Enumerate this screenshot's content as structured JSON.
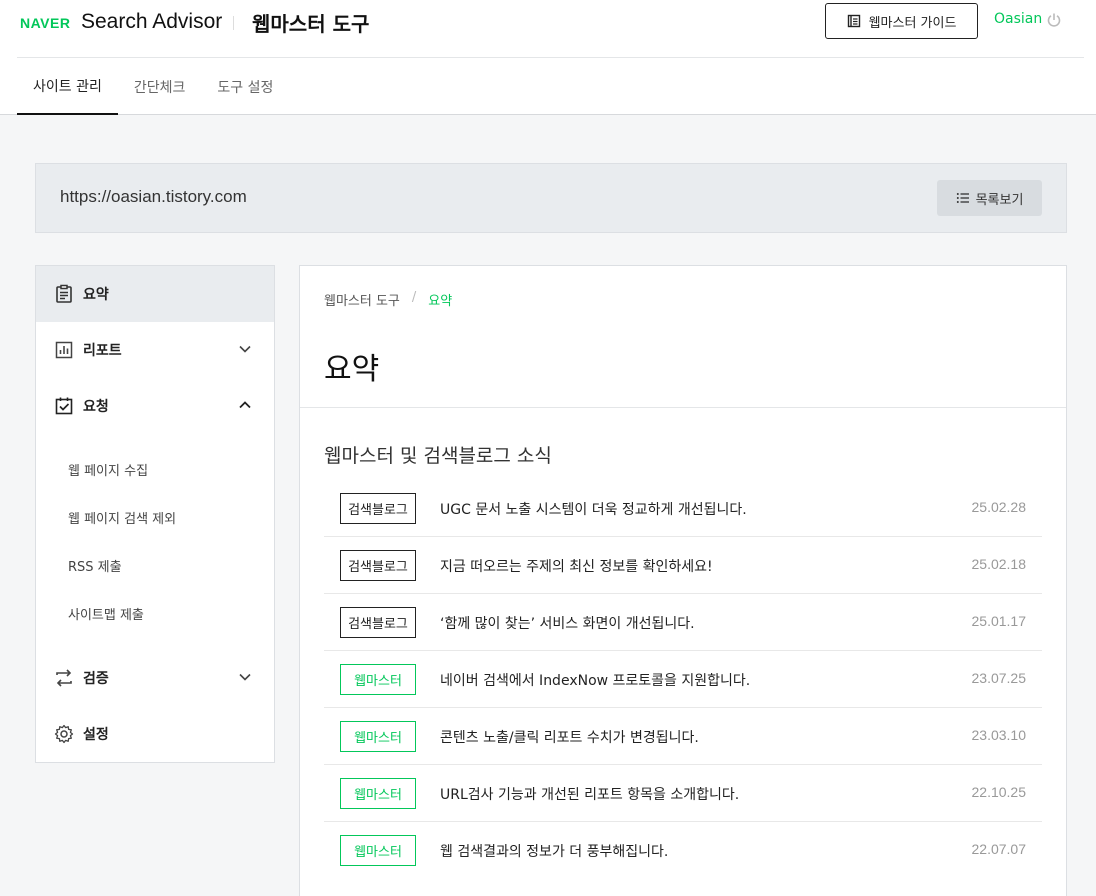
{
  "header": {
    "logo_brand": "NAVER",
    "logo_product": "Search Advisor",
    "logo_section": "웹마스터 도구",
    "guide_label": "웹마스터 가이드",
    "user_name": "Oasian",
    "accent": "#03c75a"
  },
  "tabs": [
    {
      "label": "사이트 관리",
      "active": true
    },
    {
      "label": "간단체크",
      "active": false
    },
    {
      "label": "도구 설정",
      "active": false
    }
  ],
  "site": {
    "url": "https://oasian.tistory.com",
    "list_label": "목록보기"
  },
  "sidebar": {
    "items": [
      {
        "label": "요약",
        "icon": "clipboard-icon",
        "active": true
      },
      {
        "label": "리포트",
        "icon": "chart-icon",
        "expanded": false
      },
      {
        "label": "요청",
        "icon": "checklist-icon",
        "expanded": true
      },
      {
        "label": "검증",
        "icon": "sync-icon",
        "expanded": false
      },
      {
        "label": "설정",
        "icon": "gear-icon"
      }
    ],
    "sub_items": [
      "웹 페이지 수집",
      "웹 페이지 검색 제외",
      "RSS 제출",
      "사이트맵 제출"
    ]
  },
  "main": {
    "breadcrumb": [
      "웹마스터 도구",
      "요약"
    ],
    "title": "요약",
    "section_title": "웹마스터 및 검색블로그 소식",
    "news": [
      {
        "badge": "검색블로그",
        "title": "UGC 문서 노출 시스템이 더욱 정교하게 개선됩니다.",
        "date": "25.02.28"
      },
      {
        "badge": "검색블로그",
        "title": "지금 떠오르는 주제의 최신 정보를 확인하세요!",
        "date": "25.02.18"
      },
      {
        "badge": "검색블로그",
        "title": "‘함께 많이 찾는’ 서비스 화면이 개선됩니다.",
        "date": "25.01.17"
      },
      {
        "badge": "웹마스터",
        "title": "네이버 검색에서 IndexNow 프로토콜을 지원합니다.",
        "date": "23.07.25"
      },
      {
        "badge": "웹마스터",
        "title": "콘텐츠 노출/클릭 리포트 수치가 변경됩니다.",
        "date": "23.03.10"
      },
      {
        "badge": "웹마스터",
        "title": "URL검사 기능과 개선된 리포트 항목을 소개합니다.",
        "date": "22.10.25"
      },
      {
        "badge": "웹마스터",
        "title": "웹 검색결과의 정보가 더 풍부해집니다.",
        "date": "22.07.07"
      }
    ]
  }
}
